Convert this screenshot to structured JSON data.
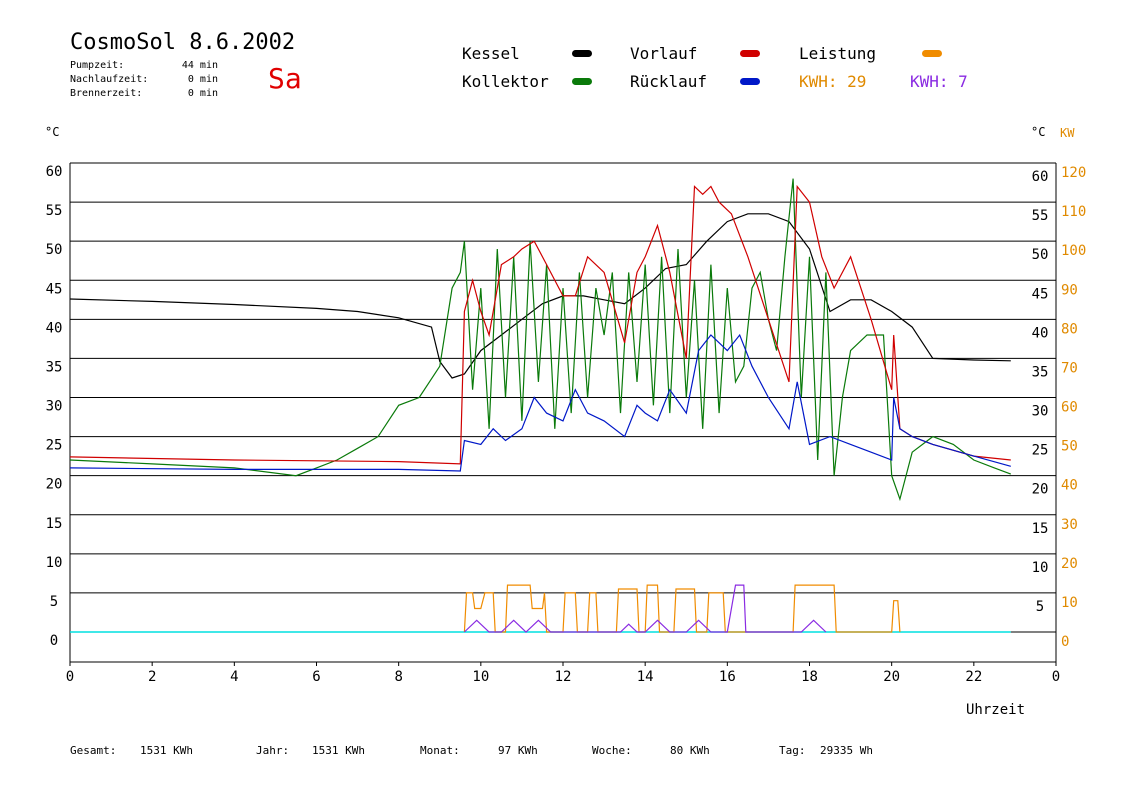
{
  "header": {
    "title": "CosmoSol 8.6.2002",
    "day": "Sa",
    "info": [
      {
        "label": "Pumpzeit:",
        "value": "44 min"
      },
      {
        "label": "Nachlaufzeit:",
        "value": "0 min"
      },
      {
        "label": "Brennerzeit:",
        "value": "0 min"
      }
    ]
  },
  "legend": {
    "kessel": "Kessel",
    "kollektor": "Kollektor",
    "vorlauf": "Vorlauf",
    "ruecklauf": "Rücklauf",
    "leistung": "Leistung",
    "kwh1": "KWH: 29",
    "kwh2": "KWH: 7"
  },
  "units": {
    "left": "°C",
    "right_c": "°C",
    "right_kw": "KW",
    "x": "Uhrzeit"
  },
  "footer": [
    {
      "label": "Gesamt:",
      "value": "1531 KWh"
    },
    {
      "label": "Jahr:",
      "value": "1531 KWh"
    },
    {
      "label": "Monat:",
      "value": "97 KWh"
    },
    {
      "label": "Woche:",
      "value": "80 KWh"
    },
    {
      "label": "Tag:",
      "value": "29335 Wh"
    }
  ],
  "colors": {
    "kessel": "#000000",
    "kollektor": "#0a7a0a",
    "vorlauf": "#d00000",
    "ruecklauf": "#0018c8",
    "leistung": "#f08c00",
    "purple": "#8a2be2",
    "baseline": "#00e0e0",
    "orange_text": "#e08a00"
  },
  "chart_data": {
    "type": "line",
    "xlabel": "Uhrzeit",
    "xlim": [
      0,
      24
    ],
    "x_ticks": [
      "0",
      "2",
      "4",
      "6",
      "8",
      "10",
      "12",
      "14",
      "16",
      "18",
      "20",
      "22",
      "0"
    ],
    "ylim": [
      0,
      60
    ],
    "y_ticks_left": [
      "0",
      "5",
      "10",
      "15",
      "20",
      "25",
      "30",
      "35",
      "40",
      "45",
      "50",
      "55",
      "60"
    ],
    "y_ticks_right_c": [
      "5",
      "10",
      "15",
      "20",
      "25",
      "30",
      "35",
      "40",
      "45",
      "50",
      "55",
      "60"
    ],
    "y_ticks_right_kw": [
      "0",
      "10",
      "20",
      "30",
      "40",
      "50",
      "60",
      "70",
      "80",
      "90",
      "100",
      "110",
      "120"
    ],
    "grid": true,
    "series": [
      {
        "name": "Kessel",
        "color_key": "kessel",
        "points": [
          [
            0,
            42.6
          ],
          [
            2,
            42.3
          ],
          [
            4,
            41.9
          ],
          [
            6,
            41.4
          ],
          [
            7,
            41
          ],
          [
            8,
            40.2
          ],
          [
            8.8,
            39
          ],
          [
            9,
            34.6
          ],
          [
            9.3,
            32.5
          ],
          [
            9.6,
            33
          ],
          [
            10,
            36
          ],
          [
            10.5,
            38
          ],
          [
            11,
            40
          ],
          [
            11.5,
            42
          ],
          [
            12,
            43
          ],
          [
            12.5,
            43
          ],
          [
            13,
            42.5
          ],
          [
            13.5,
            42
          ],
          [
            14,
            44
          ],
          [
            14.5,
            46.5
          ],
          [
            15,
            47
          ],
          [
            15.5,
            50
          ],
          [
            16,
            52.5
          ],
          [
            16.5,
            53.5
          ],
          [
            17,
            53.5
          ],
          [
            17.5,
            52.5
          ],
          [
            18,
            49
          ],
          [
            18.5,
            41
          ],
          [
            19,
            42.5
          ],
          [
            19.5,
            42.5
          ],
          [
            20,
            41
          ],
          [
            20.5,
            39
          ],
          [
            21,
            35
          ],
          [
            22,
            34.8
          ],
          [
            22.9,
            34.7
          ]
        ]
      },
      {
        "name": "Kollektor",
        "color_key": "kollektor",
        "points": [
          [
            0,
            22
          ],
          [
            2,
            21.5
          ],
          [
            4,
            21
          ],
          [
            5.5,
            20
          ],
          [
            6,
            21
          ],
          [
            6.5,
            22
          ],
          [
            7,
            23.5
          ],
          [
            7.5,
            25
          ],
          [
            8,
            29
          ],
          [
            8.5,
            30
          ],
          [
            9,
            34
          ],
          [
            9.3,
            44
          ],
          [
            9.5,
            46
          ],
          [
            9.6,
            50
          ],
          [
            9.8,
            31
          ],
          [
            10,
            44
          ],
          [
            10.2,
            26
          ],
          [
            10.4,
            49
          ],
          [
            10.6,
            30
          ],
          [
            10.8,
            48
          ],
          [
            11,
            27
          ],
          [
            11.2,
            50
          ],
          [
            11.4,
            32
          ],
          [
            11.6,
            47
          ],
          [
            11.8,
            26
          ],
          [
            12,
            44
          ],
          [
            12.2,
            28
          ],
          [
            12.4,
            46
          ],
          [
            12.6,
            30
          ],
          [
            12.8,
            44
          ],
          [
            13,
            38
          ],
          [
            13.2,
            46
          ],
          [
            13.4,
            28
          ],
          [
            13.6,
            46
          ],
          [
            13.8,
            32
          ],
          [
            14,
            47
          ],
          [
            14.2,
            29
          ],
          [
            14.4,
            48
          ],
          [
            14.6,
            28
          ],
          [
            14.8,
            49
          ],
          [
            15,
            30
          ],
          [
            15.2,
            45
          ],
          [
            15.4,
            26
          ],
          [
            15.6,
            47
          ],
          [
            15.8,
            28
          ],
          [
            16,
            44
          ],
          [
            16.2,
            32
          ],
          [
            16.4,
            34
          ],
          [
            16.6,
            44
          ],
          [
            16.8,
            46
          ],
          [
            17,
            40
          ],
          [
            17.2,
            36
          ],
          [
            17.4,
            48
          ],
          [
            17.6,
            58
          ],
          [
            17.8,
            30
          ],
          [
            18,
            48
          ],
          [
            18.2,
            22
          ],
          [
            18.4,
            46
          ],
          [
            18.6,
            20
          ],
          [
            18.8,
            30
          ],
          [
            19,
            36
          ],
          [
            19.4,
            38
          ],
          [
            19.8,
            38
          ],
          [
            20,
            20
          ],
          [
            20.2,
            17
          ],
          [
            20.5,
            23
          ],
          [
            21,
            25
          ],
          [
            21.5,
            24
          ],
          [
            22,
            22
          ],
          [
            22.5,
            21
          ],
          [
            22.9,
            20.2
          ]
        ]
      },
      {
        "name": "Vorlauf",
        "color_key": "vorlauf",
        "points": [
          [
            0,
            22.4
          ],
          [
            4,
            22
          ],
          [
            8,
            21.8
          ],
          [
            9.5,
            21.5
          ],
          [
            9.6,
            41
          ],
          [
            9.8,
            45
          ],
          [
            10,
            41
          ],
          [
            10.2,
            38
          ],
          [
            10.5,
            47
          ],
          [
            10.8,
            48
          ],
          [
            11,
            49
          ],
          [
            11.3,
            50
          ],
          [
            11.6,
            47
          ],
          [
            12,
            43
          ],
          [
            12.3,
            43
          ],
          [
            12.6,
            48
          ],
          [
            13,
            46
          ],
          [
            13.5,
            37
          ],
          [
            13.8,
            46
          ],
          [
            14,
            48
          ],
          [
            14.3,
            52
          ],
          [
            14.6,
            46
          ],
          [
            15,
            35
          ],
          [
            15.2,
            57
          ],
          [
            15.4,
            56
          ],
          [
            15.6,
            57
          ],
          [
            15.8,
            55
          ],
          [
            16,
            54
          ],
          [
            16.1,
            53.5
          ],
          [
            16.5,
            48
          ],
          [
            17,
            40
          ],
          [
            17.5,
            32
          ],
          [
            17.7,
            57
          ],
          [
            18,
            55
          ],
          [
            18.3,
            48
          ],
          [
            18.6,
            44
          ],
          [
            19,
            48
          ],
          [
            19.5,
            40
          ],
          [
            20,
            31
          ],
          [
            20.05,
            38
          ],
          [
            20.2,
            26
          ],
          [
            20.5,
            25
          ],
          [
            21,
            24
          ],
          [
            22,
            22.5
          ],
          [
            22.9,
            22
          ]
        ]
      },
      {
        "name": "Rücklauf",
        "color_key": "ruecklauf",
        "points": [
          [
            0,
            21
          ],
          [
            4,
            20.8
          ],
          [
            8,
            20.8
          ],
          [
            9.5,
            20.6
          ],
          [
            9.6,
            24.5
          ],
          [
            10,
            24
          ],
          [
            10.3,
            26
          ],
          [
            10.6,
            24.5
          ],
          [
            11,
            26
          ],
          [
            11.3,
            30
          ],
          [
            11.6,
            28
          ],
          [
            12,
            27
          ],
          [
            12.3,
            31
          ],
          [
            12.6,
            28
          ],
          [
            13,
            27
          ],
          [
            13.5,
            25
          ],
          [
            13.8,
            29
          ],
          [
            14,
            28
          ],
          [
            14.3,
            27
          ],
          [
            14.6,
            31
          ],
          [
            15,
            28
          ],
          [
            15.3,
            36
          ],
          [
            15.6,
            38
          ],
          [
            16,
            36
          ],
          [
            16.3,
            38
          ],
          [
            16.6,
            34
          ],
          [
            17,
            30
          ],
          [
            17.5,
            26
          ],
          [
            17.7,
            32
          ],
          [
            18,
            24
          ],
          [
            18.5,
            25
          ],
          [
            19,
            24
          ],
          [
            19.5,
            23
          ],
          [
            20,
            22
          ],
          [
            20.05,
            30
          ],
          [
            20.2,
            26
          ],
          [
            20.5,
            25
          ],
          [
            21,
            24
          ],
          [
            22,
            22.5
          ],
          [
            22.9,
            21.2
          ]
        ]
      },
      {
        "name": "Leistung",
        "color_key": "leistung",
        "points": [
          [
            9.6,
            0
          ],
          [
            9.65,
            5
          ],
          [
            9.8,
            5
          ],
          [
            9.85,
            3
          ],
          [
            10,
            3
          ],
          [
            10.1,
            5
          ],
          [
            10.3,
            5
          ],
          [
            10.35,
            0
          ],
          [
            10.6,
            0
          ],
          [
            10.65,
            6
          ],
          [
            11.2,
            6
          ],
          [
            11.25,
            3
          ],
          [
            11.5,
            3
          ],
          [
            11.55,
            5
          ],
          [
            11.6,
            0
          ],
          [
            12,
            0
          ],
          [
            12.05,
            5
          ],
          [
            12.3,
            5
          ],
          [
            12.35,
            0
          ],
          [
            12.6,
            0
          ],
          [
            12.65,
            5
          ],
          [
            12.8,
            5
          ],
          [
            12.85,
            0
          ],
          [
            13.3,
            0
          ],
          [
            13.35,
            5.5
          ],
          [
            13.8,
            5.5
          ],
          [
            13.85,
            0
          ],
          [
            14,
            0
          ],
          [
            14.05,
            6
          ],
          [
            14.3,
            6
          ],
          [
            14.35,
            0
          ],
          [
            14.7,
            0
          ],
          [
            14.75,
            5.5
          ],
          [
            15.2,
            5.5
          ],
          [
            15.25,
            0
          ],
          [
            15.5,
            0
          ],
          [
            15.55,
            5
          ],
          [
            15.9,
            5
          ],
          [
            15.95,
            0
          ],
          [
            17.6,
            0
          ],
          [
            17.65,
            6
          ],
          [
            18.6,
            6
          ],
          [
            18.65,
            0
          ],
          [
            20,
            0
          ],
          [
            20.05,
            4
          ],
          [
            20.15,
            4
          ],
          [
            20.2,
            0
          ]
        ]
      },
      {
        "name": "Leistung 2",
        "color_key": "purple",
        "points": [
          [
            9.6,
            0
          ],
          [
            9.9,
            1.5
          ],
          [
            10.2,
            0
          ],
          [
            10.5,
            0
          ],
          [
            10.8,
            1.5
          ],
          [
            11.1,
            0
          ],
          [
            11.4,
            1.5
          ],
          [
            11.7,
            0
          ],
          [
            13.4,
            0
          ],
          [
            13.6,
            1
          ],
          [
            13.8,
            0
          ],
          [
            14,
            0
          ],
          [
            14.3,
            1.5
          ],
          [
            14.6,
            0
          ],
          [
            15,
            0
          ],
          [
            15.3,
            1.5
          ],
          [
            15.6,
            0
          ],
          [
            16,
            0
          ],
          [
            16.2,
            6
          ],
          [
            16.4,
            6
          ],
          [
            16.45,
            0
          ],
          [
            17.8,
            0
          ],
          [
            18.1,
            1.5
          ],
          [
            18.4,
            0
          ]
        ]
      }
    ]
  }
}
